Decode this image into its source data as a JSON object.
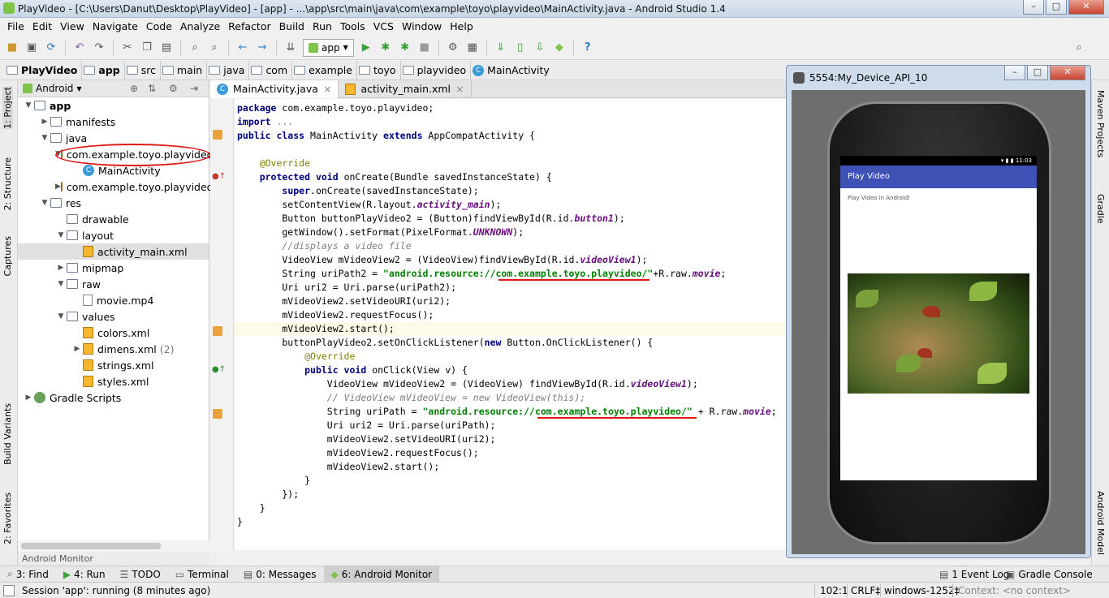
{
  "window": {
    "title": "PlayVideo - [C:\\Users\\Danut\\Desktop\\PlayVideo] - [app] - ...\\app\\src\\main\\java\\com\\example\\toyo\\playvideo\\MainActivity.java - Android Studio 1.4"
  },
  "menu": [
    "File",
    "Edit",
    "View",
    "Navigate",
    "Code",
    "Analyze",
    "Refactor",
    "Build",
    "Run",
    "Tools",
    "VCS",
    "Window",
    "Help"
  ],
  "toolbar": {
    "run_config": "app"
  },
  "breadcrumbs": [
    "PlayVideo",
    "app",
    "src",
    "main",
    "java",
    "com",
    "example",
    "toyo",
    "playvideo",
    "MainActivity"
  ],
  "project": {
    "view": "Android",
    "tree": [
      {
        "label": "app",
        "level": 0,
        "arrow": "▼",
        "icon": "folder"
      },
      {
        "label": "manifests",
        "level": 1,
        "arrow": "▶",
        "icon": "folder"
      },
      {
        "label": "java",
        "level": 1,
        "arrow": "▼",
        "icon": "folder"
      },
      {
        "label": "com.example.toyo.playvideo",
        "level": 2,
        "arrow": "▼",
        "icon": "package"
      },
      {
        "label": "MainActivity",
        "level": 3,
        "arrow": "",
        "icon": "class"
      },
      {
        "label": "com.example.toyo.playvideo",
        "level": 2,
        "arrow": "▶",
        "icon": "package"
      },
      {
        "label": "res",
        "level": 1,
        "arrow": "▼",
        "icon": "folder"
      },
      {
        "label": "drawable",
        "level": 2,
        "arrow": "",
        "icon": "folder"
      },
      {
        "label": "layout",
        "level": 2,
        "arrow": "▼",
        "icon": "folder"
      },
      {
        "label": "activity_main.xml",
        "level": 3,
        "arrow": "",
        "icon": "xml"
      },
      {
        "label": "mipmap",
        "level": 2,
        "arrow": "▶",
        "icon": "folder"
      },
      {
        "label": "raw",
        "level": 2,
        "arrow": "▼",
        "icon": "folder"
      },
      {
        "label": "movie.mp4",
        "level": 3,
        "arrow": "",
        "icon": "file"
      },
      {
        "label": "values",
        "level": 2,
        "arrow": "▼",
        "icon": "folder"
      },
      {
        "label": "colors.xml",
        "level": 3,
        "arrow": "",
        "icon": "xml"
      },
      {
        "label": "dimens.xml",
        "level": 3,
        "arrow": "▶",
        "icon": "xml",
        "suffix": "(2)"
      },
      {
        "label": "strings.xml",
        "level": 3,
        "arrow": "",
        "icon": "xml"
      },
      {
        "label": "styles.xml",
        "level": 3,
        "arrow": "",
        "icon": "xml"
      },
      {
        "label": "Gradle Scripts",
        "level": 0,
        "arrow": "▶",
        "icon": "gradle"
      }
    ]
  },
  "left_tabs": {
    "project": "1: Project",
    "structure": "2: Structure",
    "captures": "Captures",
    "build_variants": "Build Variants",
    "favorites": "2: Favorites"
  },
  "right_tabs": {
    "maven": "Maven Projects",
    "gradle": "Gradle",
    "android_model": "Android Model"
  },
  "editor": {
    "tabs": [
      "MainActivity.java",
      "activity_main.xml"
    ],
    "lines": [
      "<span class=\"kw\">package</span> com.example.toyo.playvideo;",
      "<span class=\"kw\">import</span> <span class=\"cm\" style=\"font-style:normal;color:#808080\">...</span>",
      "<span class=\"kw\">public class</span> MainActivity <span class=\"kw\">extends</span> AppCompatActivity {",
      "",
      "    <span class=\"an\">@Override</span>",
      "    <span class=\"kw\">protected void</span> onCreate(Bundle savedInstanceState) {",
      "        <span class=\"kw\">super</span>.onCreate(savedInstanceState);",
      "        setContentView(R.layout.<span class=\"fd\">activity_main</span>);",
      "        Button buttonPlayVideo2 = (Button)findViewById(R.id.<span class=\"fd\">button1</span>);",
      "        getWindow().setFormat(PixelFormat.<span class=\"fd\">UNKNOWN</span>);",
      "        <span class=\"cm\">//displays a video file</span>",
      "        VideoView mVideoView2 = (VideoView)findViewById(R.id.<span class=\"fd\">videoView1</span>);",
      "        String uriPath2 = <span class=\"st\">\"android.resource://com.example.toyo.playvideo/\"</span>+R.raw.<span class=\"fd\">movie</span>;",
      "        Uri uri2 = Uri.parse(uriPath2);",
      "        mVideoView2.setVideoURI(uri2);",
      "        mVideoView2.requestFocus();",
      "        mVideoView2.start();",
      "        buttonPlayVideo2.setOnClickListener(<span class=\"kw\">new</span> Button.OnClickListener() {",
      "            <span class=\"an\">@Override</span>",
      "            <span class=\"kw\">public void</span> onClick(View v) {",
      "                VideoView mVideoView2 = (VideoView) findViewById(R.id.<span class=\"fd\">videoView1</span>);",
      "                <span class=\"cm\">// VideoView mVideoView = new VideoView(this);</span>",
      "                String uriPath = <span class=\"st\">\"android.resource://com.example.toyo.playvideo/\"</span> + R.raw.<span class=\"fd\">movie</span>;",
      "                Uri uri2 = Uri.parse(uriPath);",
      "                mVideoView2.setVideoURI(uri2);",
      "                mVideoView2.requestFocus();",
      "                mVideoView2.start();",
      "            }",
      "        });",
      "    }",
      "}"
    ]
  },
  "emulator": {
    "title": "5554:My_Device_API_10",
    "status_time": "11:03",
    "app_title": "Play Video",
    "body_text": "Play Video in Android!"
  },
  "bottom": {
    "monitor_label": "Android Monitor",
    "tools": [
      "3: Find",
      "4: Run",
      "TODO",
      "Terminal",
      "0: Messages",
      "6: Android Monitor"
    ],
    "right_tools": [
      "1 Event Log",
      "Gradle Console"
    ]
  },
  "status": {
    "message": "Session 'app': running (8 minutes ago)",
    "position": "102:1",
    "line_sep": "CRLF‡",
    "encoding": "windows-1252‡",
    "context": "Context: <no context>"
  }
}
